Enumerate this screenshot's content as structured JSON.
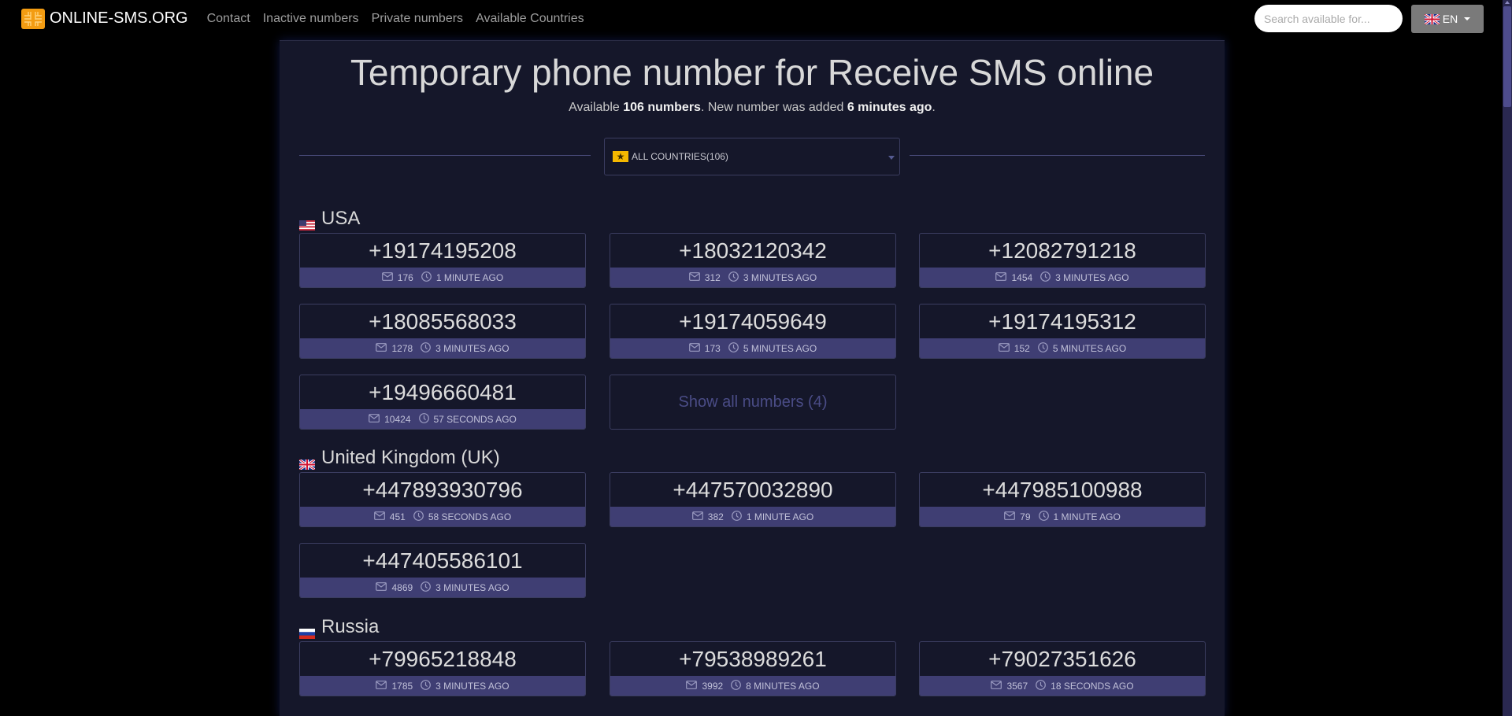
{
  "navbar": {
    "brand": "ONLINE-SMS.ORG",
    "brand_color": "#f39c12",
    "links": [
      "Contact",
      "Inactive numbers",
      "Private numbers",
      "Available Countries"
    ],
    "search_placeholder": "Search available for...",
    "language": "EN"
  },
  "header": {
    "title": "Temporary phone number for Receive SMS online",
    "subtitle_prefix": "Available ",
    "subtitle_count": "106 numbers",
    "subtitle_middle": ". New number was added ",
    "subtitle_time": "6 minutes ago",
    "subtitle_suffix": "."
  },
  "filter": {
    "selected": "ALL COUNTRIES(106)"
  },
  "colors": {
    "background": "#000000",
    "panel": "#15172a",
    "card_meta": "#3f3e73",
    "card_border": "#3b3d60",
    "accent_star": "#f5b800"
  },
  "countries": [
    {
      "name": "USA",
      "flag": "us-flag",
      "numbers": [
        {
          "number": "+19174195208",
          "sms": "176",
          "time": "1 MINUTE AGO"
        },
        {
          "number": "+18032120342",
          "sms": "312",
          "time": "3 MINUTES AGO"
        },
        {
          "number": "+12082791218",
          "sms": "1454",
          "time": "3 MINUTES AGO"
        },
        {
          "number": "+18085568033",
          "sms": "1278",
          "time": "3 MINUTES AGO"
        },
        {
          "number": "+19174059649",
          "sms": "173",
          "time": "5 MINUTES AGO"
        },
        {
          "number": "+19174195312",
          "sms": "152",
          "time": "5 MINUTES AGO"
        },
        {
          "number": "+19496660481",
          "sms": "10424",
          "time": "57 SECONDS AGO"
        }
      ],
      "show_all": "Show all numbers (4)"
    },
    {
      "name": "United Kingdom (UK)",
      "flag": "uk-flag",
      "numbers": [
        {
          "number": "+447893930796",
          "sms": "451",
          "time": "58 SECONDS AGO"
        },
        {
          "number": "+447570032890",
          "sms": "382",
          "time": "1 MINUTE AGO"
        },
        {
          "number": "+447985100988",
          "sms": "79",
          "time": "1 MINUTE AGO"
        },
        {
          "number": "+447405586101",
          "sms": "4869",
          "time": "3 MINUTES AGO"
        }
      ]
    },
    {
      "name": "Russia",
      "flag": "russia-flag",
      "numbers": [
        {
          "number": "+79965218848",
          "sms": "1785",
          "time": "3 MINUTES AGO"
        },
        {
          "number": "+79538989261",
          "sms": "3992",
          "time": "8 MINUTES AGO"
        },
        {
          "number": "+79027351626",
          "sms": "3567",
          "time": "18 SECONDS AGO"
        }
      ]
    }
  ]
}
